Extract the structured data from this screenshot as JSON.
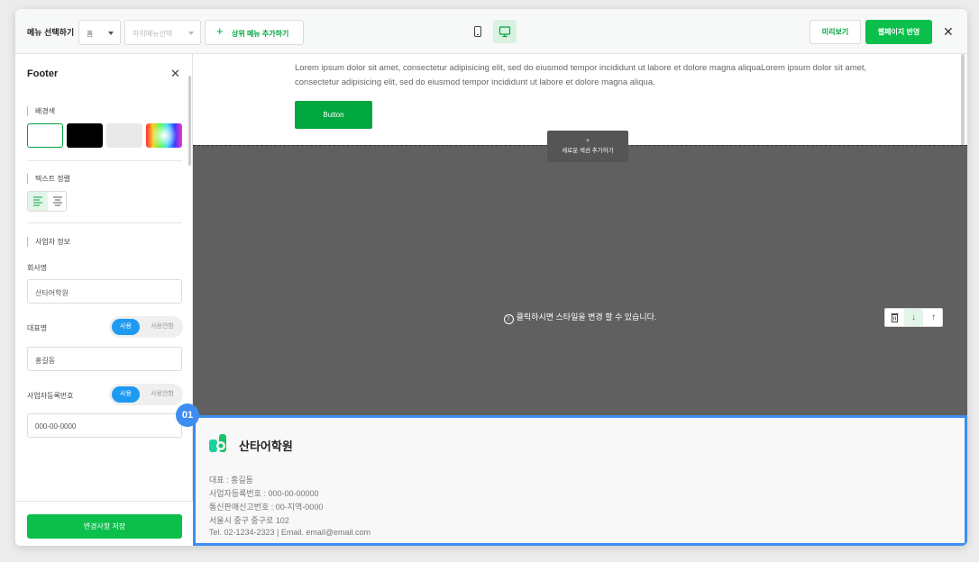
{
  "toolbar": {
    "menu_label": "메뉴 선택하기",
    "menu_select_value": "홈",
    "submenu_select_placeholder": "하위메뉴선택",
    "add_top_menu_label": "상위 메뉴 추가하기",
    "preview_label": "미리보기",
    "publish_label": "웹페이지 반영",
    "close_icon": "close-icon",
    "devices": [
      {
        "name": "mobile-icon",
        "active": false
      },
      {
        "name": "desktop-icon",
        "active": true
      }
    ]
  },
  "sidebar": {
    "title": "Footer",
    "background_section": "배경색",
    "swatches": [
      "#ffffff",
      "#000000",
      "#e9e9e9",
      "rainbow"
    ],
    "text_align_section": "텍스트 정렬",
    "business_section": "사업자 정보",
    "company_label": "회사명",
    "company_value": "산타어학원",
    "ceo_label": "대표명",
    "ceo_toggle_on": "사용",
    "ceo_toggle_off": "사용안함",
    "ceo_value": "홍길동",
    "reg_label": "사업자등록번호",
    "reg_toggle_on": "사용",
    "reg_toggle_off": "사용안함",
    "reg_value": "000-00-0000",
    "save_label": "변경사항 저장"
  },
  "canvas": {
    "lorem": "Lorem ipsum dolor sit amet, consectetur adipisicing elit, sed do eiusmod tempor incididunt ut labore et dolore magna aliquaLorem ipsum dolor sit amet, consectetur adipisicing elit, sed do eiusmod tempor incididunt ut labore et dolore magna aliqua.",
    "button_label": "Button",
    "add_section_plus": "+",
    "add_section_label": "새로운 섹션 추가하기",
    "notice": "클릭하시면 스타일을 변경 할 수 있습니다.",
    "badge": "01",
    "footer": {
      "brand": "산타어학원",
      "lines": [
        "대표 : 홍길동",
        "사업자등록번호 : 000-00-00000",
        "통신판매신고번호 : 00-지역-0000",
        "서울시 중구 중구로 102",
        "Tel. 02-1234-2323 | Email. email@email.com"
      ]
    }
  },
  "colors": {
    "accent_green": "#0bbf4a",
    "selection_blue": "#3d8ef0",
    "section_gray": "#606060"
  }
}
